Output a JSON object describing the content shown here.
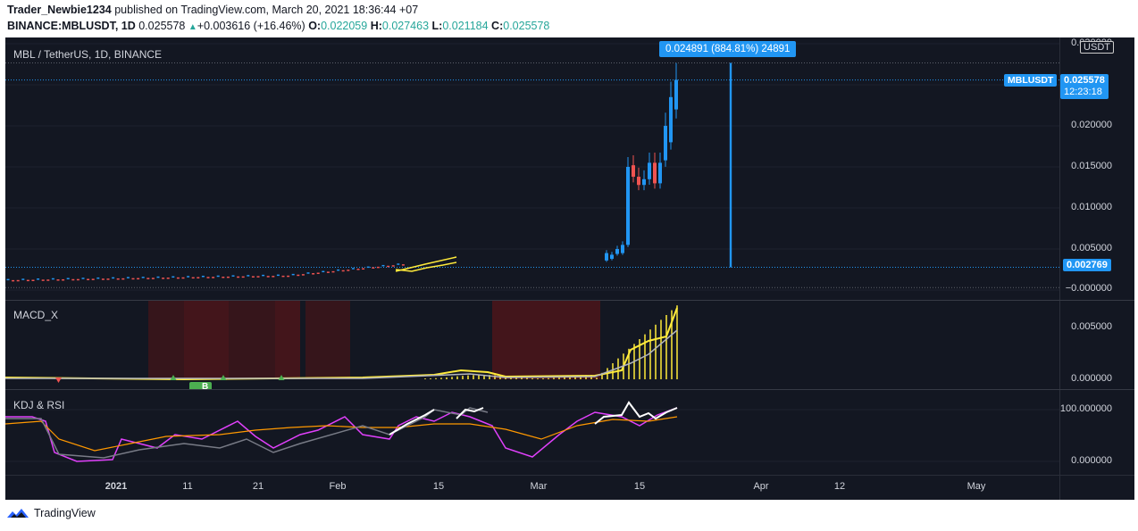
{
  "header": {
    "author": "Trader_Newbie1234",
    "published_text": "published on TradingView.com, March 20, 2021 18:36:44 +07",
    "symbol_line": "BINANCE:MBLUSDT, 1D",
    "last": "0.025578",
    "change": "+0.003616 (+16.46%)",
    "o_label": "O:",
    "o_val": "0.022059",
    "h_label": "H:",
    "h_val": "0.027463",
    "l_label": "L:",
    "l_val": "0.021184",
    "c_label": "C:",
    "c_val": "0.025578"
  },
  "main_pane": {
    "title": "MBL / TetherUS, 1D, BINANCE",
    "currency_badge": "USDT",
    "measure_label": "0.024891 (884.81%) 24891",
    "symbol_badge": "MBLUSDT",
    "current_price": "0.025578",
    "countdown": "12:23:18",
    "low_price_label": "0.002769",
    "ticks": [
      "0.030000",
      "0.025000",
      "0.020000",
      "0.015000",
      "0.010000",
      "0.005000",
      "−0.000000"
    ]
  },
  "macd_pane": {
    "title": "MACD_X",
    "ticks": [
      "0.005000",
      "0.000000"
    ],
    "marker_label": "B"
  },
  "kdj_pane": {
    "title": "KDJ & RSI",
    "ticks": [
      "100.000000",
      "0.000000"
    ]
  },
  "date_axis": {
    "labels": [
      "2021",
      "11",
      "21",
      "Feb",
      "15",
      "Mar",
      "15",
      "Apr",
      "12",
      "May"
    ]
  },
  "footer": {
    "brand": "TradingView"
  },
  "colors": {
    "up": "#2196f3",
    "down": "#ef5350",
    "background": "#131722",
    "macd_line": "#ffeb3b",
    "signal": "#b2b5be",
    "k_line": "#ffffff",
    "d_line": "#e040fb",
    "rsi_line": "#ff9800",
    "accent": "#2962ff"
  },
  "chart_data": {
    "type": "candlestick",
    "x_range": [
      "2020-12-15",
      "2021-05-10"
    ],
    "ylim": [
      0,
      0.03
    ],
    "last_close": 0.025578,
    "measured_move": {
      "from": 0.002769,
      "to": 0.02766,
      "change": 0.024891,
      "pct": 884.81
    }
  }
}
